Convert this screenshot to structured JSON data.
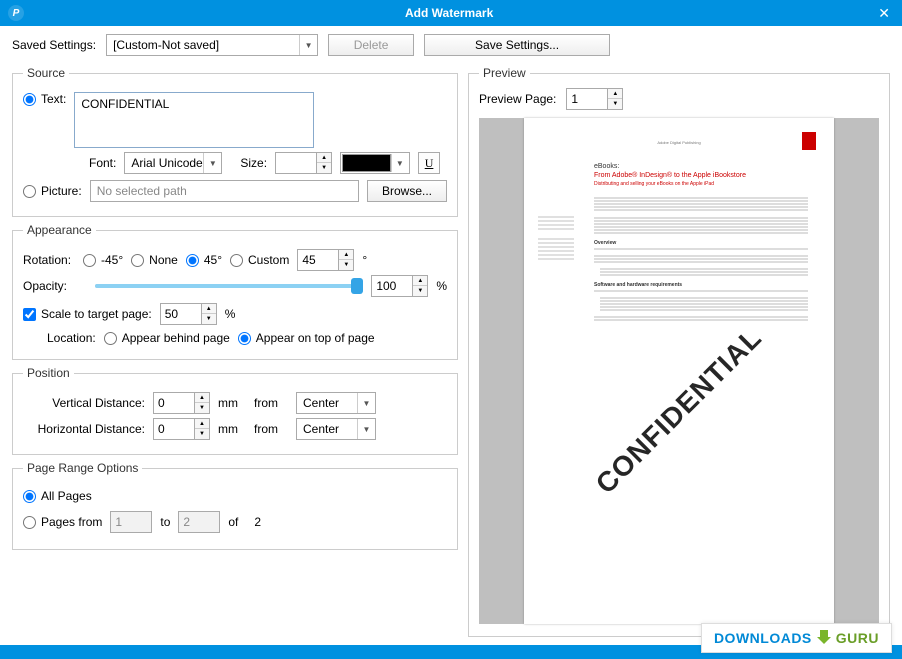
{
  "titlebar": {
    "title": "Add Watermark",
    "close": "✕"
  },
  "toolbar": {
    "saved_settings_label": "Saved Settings:",
    "saved_settings_value": "[Custom-Not saved]",
    "delete_label": "Delete",
    "save_label": "Save Settings..."
  },
  "source": {
    "legend": "Source",
    "text_label": "Text:",
    "text_value": "CONFIDENTIAL",
    "font_label": "Font:",
    "font_value": "Arial Unicode",
    "size_label": "Size:",
    "size_value": "",
    "color_value": "#000000",
    "picture_label": "Picture:",
    "picture_path": "No selected path",
    "browse_label": "Browse..."
  },
  "appearance": {
    "legend": "Appearance",
    "rotation_label": "Rotation:",
    "rot_neg45": "-45°",
    "rot_none": "None",
    "rot_45": "45°",
    "rot_custom": "Custom",
    "rot_custom_value": "45",
    "rot_degree": "°",
    "opacity_label": "Opacity:",
    "opacity_value": "100",
    "opacity_pct": "%",
    "scale_label": "Scale to target page:",
    "scale_value": "50",
    "scale_pct": "%",
    "location_label": "Location:",
    "loc_behind": "Appear behind page",
    "loc_top": "Appear on top of page"
  },
  "position": {
    "legend": "Position",
    "v_label": "Vertical Distance:",
    "h_label": "Horizontal Distance:",
    "v_value": "0",
    "h_value": "0",
    "unit": "mm",
    "from_label": "from",
    "v_from": "Center",
    "h_from": "Center"
  },
  "pagerange": {
    "legend": "Page Range Options",
    "all_label": "All Pages",
    "from_label": "Pages from",
    "from_value": "1",
    "to_label": "to",
    "to_value": "2",
    "of_label": "of",
    "total": "2"
  },
  "preview": {
    "legend": "Preview",
    "page_label": "Preview Page:",
    "page_value": "1",
    "doc_header": "Adobe Digital Publishing",
    "doc_title_line1": "eBooks:",
    "doc_title_line2": "From Adobe® InDesign® to the Apple iBookstore",
    "doc_subtitle": "Distributing and selling your eBooks on the Apple iPad",
    "doc_sec1": "Overview",
    "doc_sec2": "Software and hardware requirements",
    "watermark_text": "CONFIDENTIAL"
  },
  "badge": {
    "text1": "DOWNLOADS",
    "text2": "GURU"
  }
}
